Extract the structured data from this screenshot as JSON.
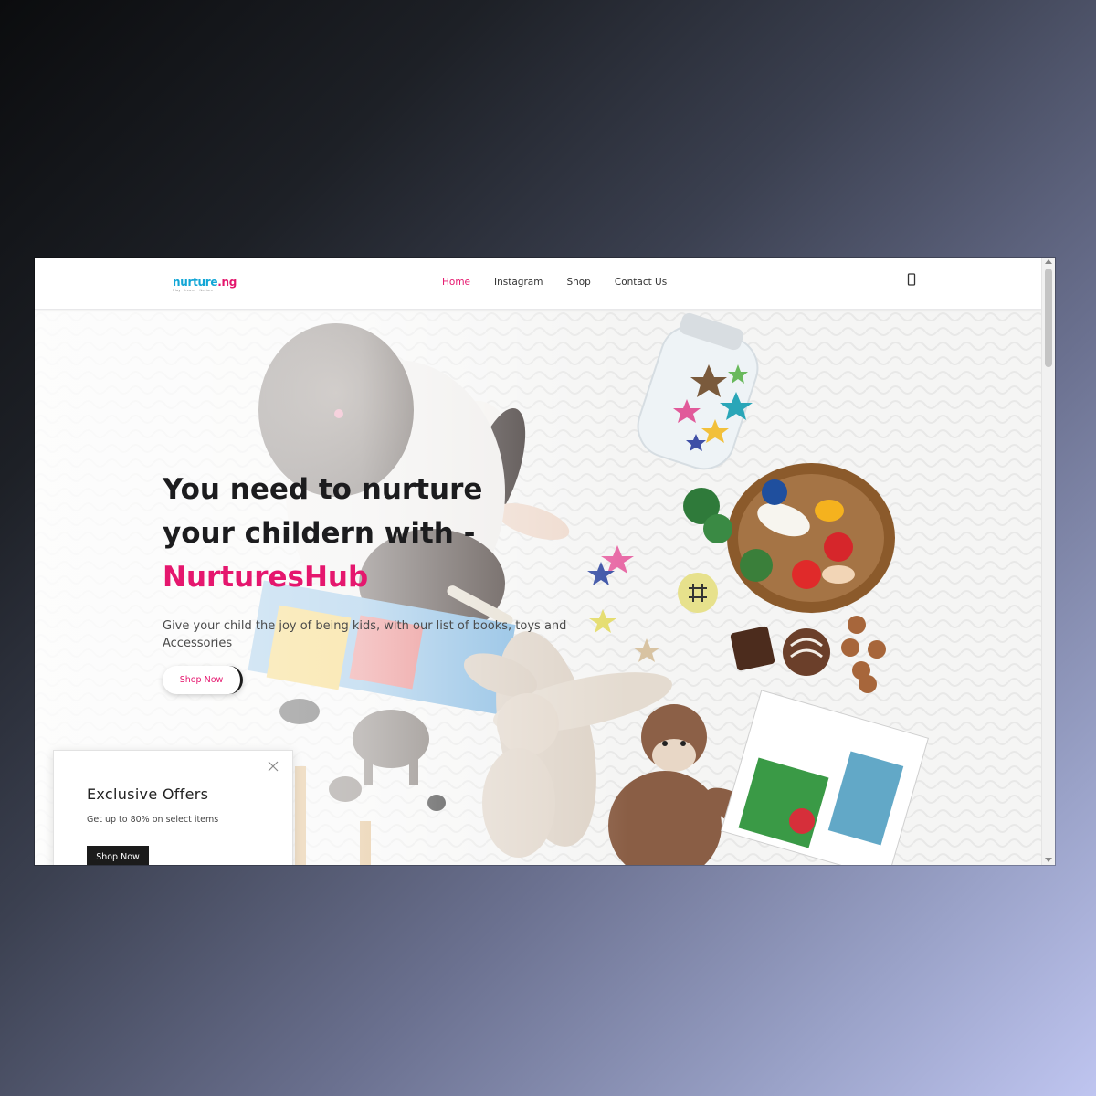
{
  "header": {
    "logo_text_a": "nurture",
    "logo_text_b": ".ng",
    "logo_tagline": "Play · Learn · Nurture",
    "nav": [
      {
        "label": "Home",
        "active": true
      },
      {
        "label": "Instagram",
        "active": false
      },
      {
        "label": "Shop",
        "active": false
      },
      {
        "label": "Contact Us",
        "active": false
      }
    ],
    "menu_icon": "device-icon"
  },
  "hero": {
    "headline_line1": "You need to nurture",
    "headline_line2": "your childern with -",
    "headline_brand": "NurturesHub",
    "subtext": "Give your child the joy of being kids, with our list of books, toys and Accessories",
    "cta_label": "Shop Now"
  },
  "popup": {
    "title": "Exclusive Offers",
    "text": "Get up to 80% on select items",
    "button_label": "Shop Now",
    "close_icon": "close-icon"
  },
  "colors": {
    "accent": "#e5176e",
    "logo_blue": "#12a6d6",
    "dark": "#1b1b1b"
  }
}
